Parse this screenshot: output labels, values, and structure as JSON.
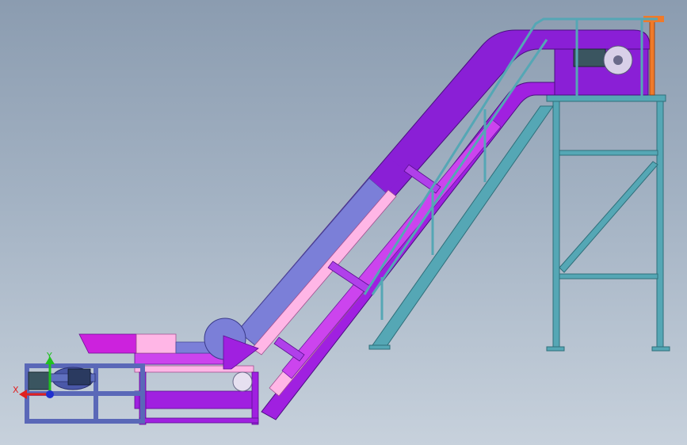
{
  "viewport": {
    "background_top": "#8b9cb0",
    "background_bottom": "#c7d1dc"
  },
  "triad": {
    "x_label": "X",
    "y_label": "Y",
    "x_color": "#e02020",
    "y_color": "#20c020",
    "z_color": "#2030d0"
  },
  "model": {
    "belt_color": "#8a1fd6",
    "belt_light_color": "#ff9ed8",
    "belt_blue_color": "#7b7fd8",
    "frame_color": "#55a7b5",
    "frame_dark_color": "#2f6f7a",
    "hopper_color": "#cc22dd",
    "base_frame_color": "#5a68b8",
    "motor_color": "#3a5560",
    "guard_color": "#f07a2a"
  }
}
